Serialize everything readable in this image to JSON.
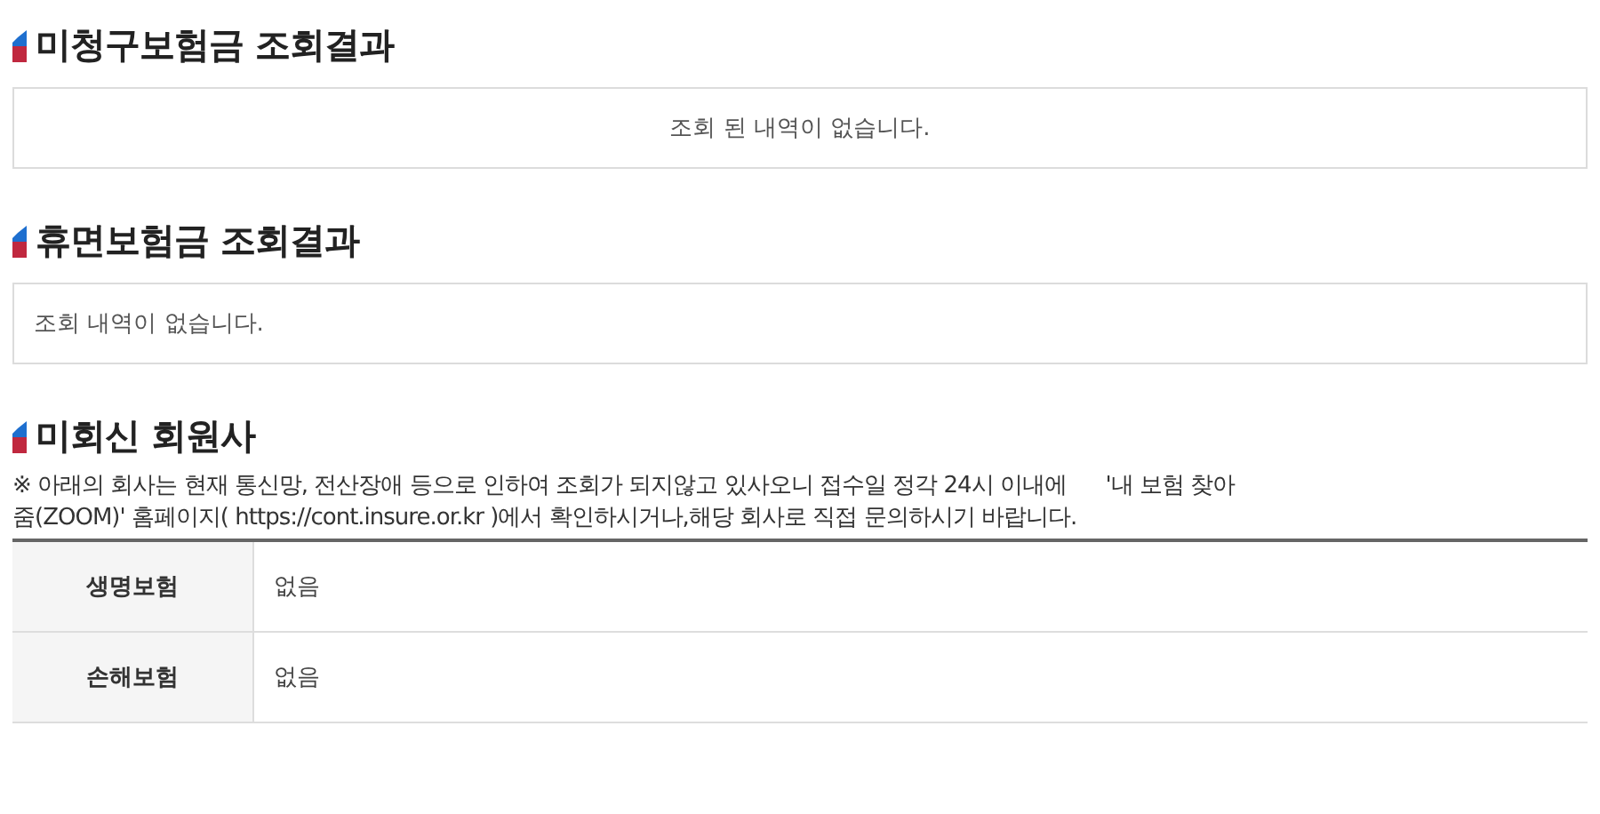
{
  "sections": [
    {
      "kind": "message",
      "title": "미청구보험금 조회결과",
      "message": "조회 된 내역이 없습니다.",
      "centered": true
    },
    {
      "kind": "message",
      "title": "휴면보험금 조회결과",
      "message": "조회 내역이 없습니다.",
      "centered": false
    },
    {
      "kind": "table",
      "title": "미회신 회원사",
      "notice": "※ 아래의 회사는 현재 통신망, 전산장애 등으로 인하여 조회가 되지않고 있사오니 접수일 정각 24시 이내에      '내 보험 찾아 줌(ZOOM)' 홈페이지( https://cont.insure.or.kr )에서 확인하시거나,해당 회사로 직접 문의하시기 바랍니다.",
      "rows": [
        {
          "label": "생명보험",
          "value": "없음"
        },
        {
          "label": "손해보험",
          "value": "없음"
        }
      ]
    }
  ]
}
